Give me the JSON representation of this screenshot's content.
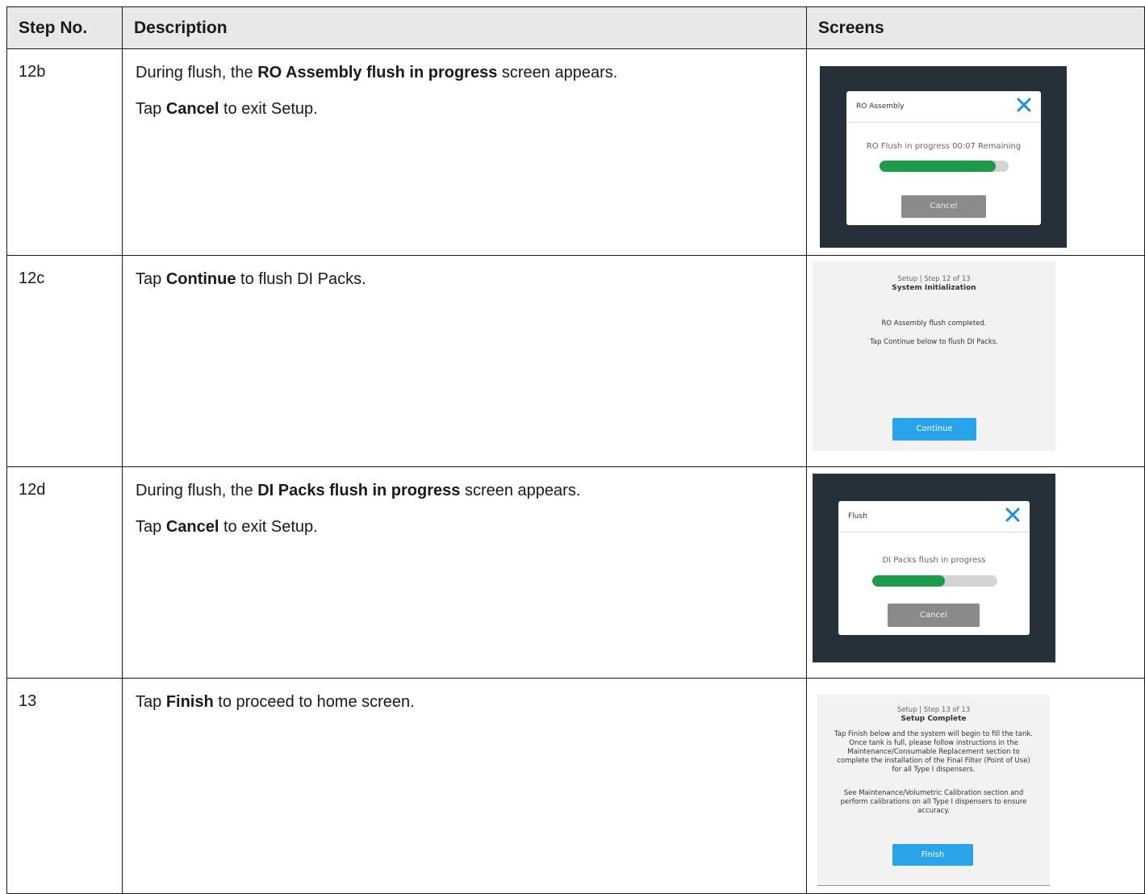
{
  "headers": {
    "step": "Step No.",
    "description": "Description",
    "screens": "Screens"
  },
  "rows": [
    {
      "step": "12b",
      "line1": {
        "pre": "During flush, the ",
        "bold": "RO Assembly flush in progress",
        "post": " screen appears."
      },
      "line2": {
        "pre": "Tap ",
        "bold": "Cancel",
        "post": " to exit Setup."
      },
      "screen": {
        "modal_title": "RO Assembly",
        "message": "RO Flush in progress 00:07 Remaining",
        "progress": 0.9,
        "button": "Cancel"
      }
    },
    {
      "step": "12c",
      "line1": {
        "pre": "Tap ",
        "bold": "Continue",
        "post": " to flush DI Packs."
      },
      "screen": {
        "subtitle": "Setup | Step 12 of 13",
        "title": "System Initialization",
        "line1": "RO Assembly flush completed.",
        "line2": "Tap Continue below to flush DI Packs.",
        "button": "Continue"
      }
    },
    {
      "step": "12d",
      "line1": {
        "pre": "During flush, the ",
        "bold": "DI Packs flush in progress",
        "post": " screen appears."
      },
      "line2": {
        "pre": "Tap ",
        "bold": "Cancel",
        "post": " to exit Setup."
      },
      "screen": {
        "modal_title": "Flush",
        "message": "DI Packs flush in progress",
        "progress": 0.58,
        "button": "Cancel"
      }
    },
    {
      "step": "13",
      "line1": {
        "pre": "Tap ",
        "bold": "Finish",
        "post": " to proceed to home screen."
      },
      "screen": {
        "subtitle": "Setup | Step 13 of 13",
        "title": "Setup Complete",
        "para1": [
          "Tap Finish below and the system will begin to fill the tank.",
          "Once tank is full, please follow instructions in the",
          "Maintenance/Consumable Replacement section to",
          "complete the installation of the Final Filter (Point of Use)",
          "for all Type I dispensers."
        ],
        "para2": [
          "See Maintenance/Volumetric Calibration section and",
          "perform calibrations on all Type I dispensers to ensure",
          "accuracy."
        ],
        "button": "Finish"
      }
    }
  ],
  "colors": {
    "dark_bg": "#263039",
    "progress_green": "#1e9b4a",
    "button_blue": "#29a3ea",
    "close_blue": "#1f8fe0"
  }
}
